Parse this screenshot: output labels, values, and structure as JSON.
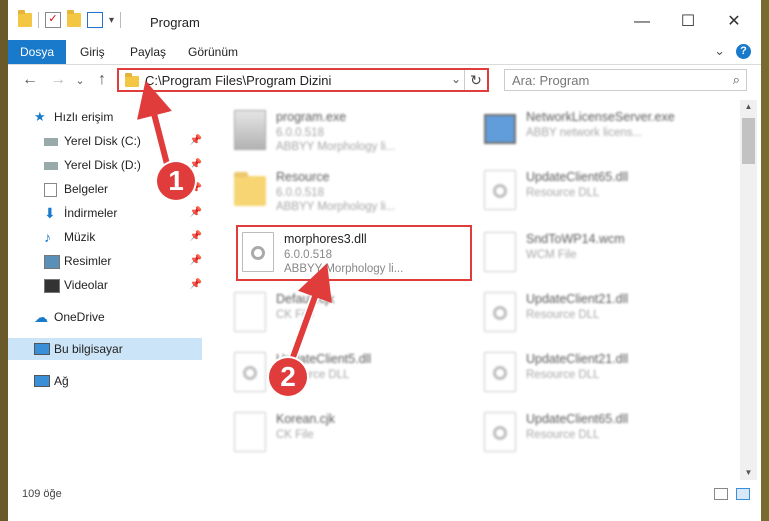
{
  "window": {
    "title": "Program",
    "controls": {
      "minimize": "—",
      "maximize": "☐",
      "close": "✕"
    }
  },
  "ribbon": {
    "file_tab": "Dosya",
    "tabs": [
      "Giriş",
      "Paylaş",
      "Görünüm"
    ],
    "help": "?"
  },
  "navigation": {
    "back": "←",
    "forward": "→",
    "dropdown": "⌄",
    "up": "↑",
    "address": "C:\\Program Files\\Program Dizini",
    "address_dropdown": "⌄",
    "refresh": "↻",
    "search_placeholder": "Ara: Program",
    "search_icon": "🔍"
  },
  "sidebar": {
    "quick_access": "Hızlı erişim",
    "items": [
      {
        "label": "Yerel Disk (C:)",
        "icon": "drive-icon",
        "pinned": true
      },
      {
        "label": "Yerel Disk (D:)",
        "icon": "drive-icon",
        "pinned": true
      },
      {
        "label": "Belgeler",
        "icon": "documents-icon",
        "pinned": true
      },
      {
        "label": "İndirmeler",
        "icon": "downloads-icon",
        "pinned": true
      },
      {
        "label": "Müzik",
        "icon": "music-icon",
        "pinned": true
      },
      {
        "label": "Resimler",
        "icon": "pictures-icon",
        "pinned": true
      },
      {
        "label": "Videolar",
        "icon": "videos-icon",
        "pinned": true
      }
    ],
    "onedrive": "OneDrive",
    "this_pc": "Bu bilgisayar",
    "network": "Ağ"
  },
  "files": {
    "left": [
      {
        "name": "program.exe",
        "line2": "6.0.0.518",
        "line3": "ABBYY Morphology li...",
        "icon": "exe-icon"
      },
      {
        "name": "Resource",
        "line2": "6.0.0.518",
        "line3": "ABBYY Morphology li...",
        "icon": "folder-icon"
      },
      {
        "name": "morphores3.dll",
        "line2": "6.0.0.518",
        "line3": "ABBYY Morphology li...",
        "icon": "dll-icon"
      },
      {
        "name": "Default.cjk",
        "line2": "CK File",
        "line3": "",
        "icon": "file-icon"
      },
      {
        "name": "UpdateClient5.dll",
        "line2": "Resource DLL",
        "line3": "",
        "icon": "dll-icon"
      },
      {
        "name": "Korean.cjk",
        "line2": "CK File",
        "line3": "",
        "icon": "file-icon"
      }
    ],
    "right": [
      {
        "name": "NetworkLicenseServer.exe",
        "line2": "ABBY network licens...",
        "icon": "window-icon"
      },
      {
        "name": "UpdateClient65.dll",
        "line2": "Resource DLL",
        "icon": "dll-icon"
      },
      {
        "name": "SndToWP14.wcm",
        "line2": "WCM File",
        "icon": "file-icon"
      },
      {
        "name": "UpdateClient21.dll",
        "line2": "Resource DLL",
        "icon": "dll-icon"
      },
      {
        "name": "UpdateClient21.dll",
        "line2": "Resource DLL",
        "icon": "dll-icon"
      },
      {
        "name": "UpdateClient65.dll",
        "line2": "Resource DLL",
        "icon": "dll-icon"
      }
    ]
  },
  "annotations": {
    "step1": "1",
    "step2": "2",
    "color": "#e03c3c"
  },
  "status": {
    "item_count": "109 öğe"
  }
}
